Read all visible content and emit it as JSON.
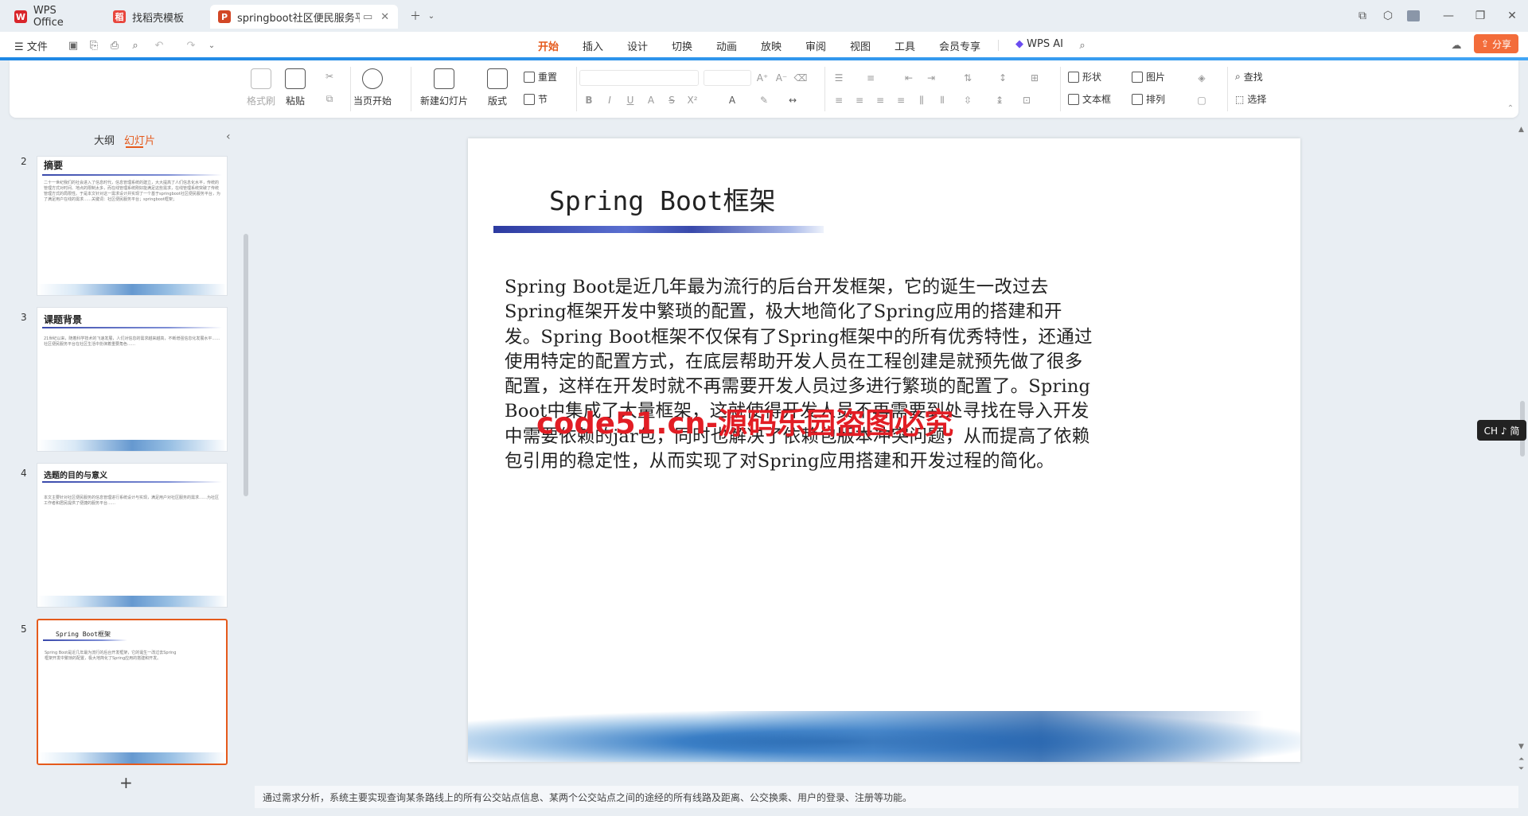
{
  "tabs": [
    {
      "label": "WPS Office",
      "icon": "wps-logo-icon"
    },
    {
      "label": "找稻壳模板",
      "icon": "docer-icon"
    },
    {
      "label": "springboot社区便民服务平",
      "icon": "ppt-icon"
    }
  ],
  "menu": {
    "file": "文件",
    "items": [
      "开始",
      "插入",
      "设计",
      "切换",
      "动画",
      "放映",
      "审阅",
      "视图",
      "工具",
      "会员专享"
    ],
    "active": "开始",
    "wps_ai": "WPS AI",
    "share": "分享"
  },
  "ribbon": {
    "format_painter": "格式刷",
    "paste": "粘贴",
    "play_from_current": "当页开始",
    "new_slide": "新建幻灯片",
    "layout": "版式",
    "section": "节",
    "reset": "重置",
    "shape": "形状",
    "picture": "图片",
    "textbox": "文本框",
    "arrange": "排列",
    "find": "查找",
    "select": "选择"
  },
  "left_panel": {
    "outline_tab": "大纲",
    "slides_tab": "幻灯片",
    "thumbnails": [
      {
        "num": "2",
        "title": "摘要",
        "text": "二十一世纪我们的社会进入了信息时代，信息管理系统的建立，大大提高了人们信息化水平，传统的管理方式对时间、地点的限制太多，而在线管理系统刚好能满足这些需求，在线管理系统突破了传统管理方式的局限性。于是本文针对这一需求设计并实现了一个基于springboot社区便民服务平台，为了满足用户在线的需求……关键词：社区便民服务平台；springboot框架；"
      },
      {
        "num": "3",
        "title": "课题背景",
        "text": "21世纪以来，随着科学技术的飞速发展，人们对信息的需求越来越高，不断增强信息化发展水平……社区便民服务平台在社区生活中扮演着重要角色……"
      },
      {
        "num": "4",
        "title": "选题的目的与意义",
        "text": "本文主要针对社区便民服务的信息管理进行系统设计与实现，满足用户对社区服务的需求……为社区工作者和居民提供了便捷的服务平台……"
      },
      {
        "num": "5",
        "title": "Spring Boot框架",
        "text": "Spring Boot是近几年最为流行的后台开发框架，它的诞生一改过去Spring框架开发中繁琐的配置，极大地简化了Spring应用的搭建和开发。"
      }
    ]
  },
  "slide": {
    "title": "Spring Boot框架",
    "body": "Spring Boot是近几年最为流行的后台开发框架，它的诞生一改过去Spring框架开发中繁琐的配置，极大地简化了Spring应用的搭建和开发。Spring Boot框架不仅保有了Spring框架中的所有优秀特性，还通过使用特定的配置方式，在底层帮助开发人员在工程创建是就预先做了很多配置，这样在开发时就不再需要开发人员过多进行繁琐的配置了。Spring Boot中集成了大量框架，这就使得开发人员不再需要到处寻找在导入开发中需要依赖的jar包，同时也解决了依赖包版本冲突问题，从而提高了依赖包引用的稳定性，从而实现了对Spring应用搭建和开发过程的简化。",
    "watermark": "code51.cn-源码乐园盗图必究"
  },
  "notes": "通过需求分析，系统主要实现查询某条路线上的所有公交站点信息、某两个公交站点之间的途经的所有线路及距离、公交换乘、用户的登录、注册等功能。",
  "ime_badge": "CH ♪ 简",
  "accent_color": "#e55a1c"
}
